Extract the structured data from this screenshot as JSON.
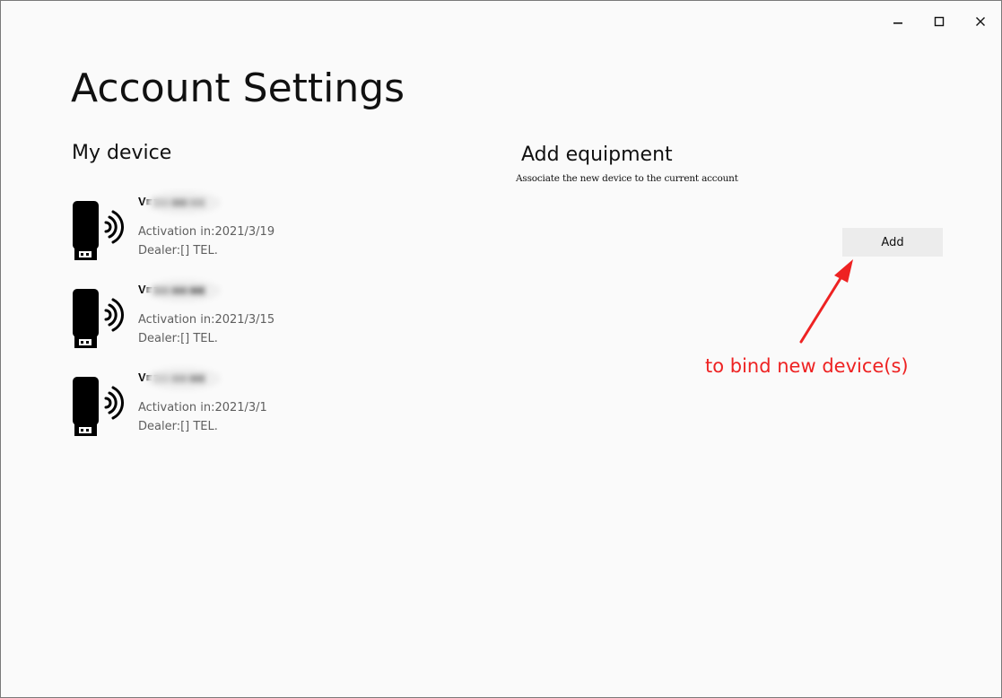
{
  "window": {
    "controls": [
      {
        "name": "minimize",
        "glyph": "–"
      },
      {
        "name": "maximize",
        "glyph": "☐"
      },
      {
        "name": "close",
        "glyph": "✕"
      }
    ]
  },
  "page": {
    "title": "Account Settings"
  },
  "my_device": {
    "heading": "My device",
    "devices": [
      {
        "name": "V■■■■■■00",
        "activation": "Activation in:2021/3/19",
        "dealer": "Dealer:[] TEL.",
        "icon": "usb-wireless-dongle-icon"
      },
      {
        "name": "V■■■■■■01",
        "activation": "Activation in:2021/3/15",
        "dealer": "Dealer:[] TEL.",
        "icon": "usb-wireless-dongle-icon"
      },
      {
        "name": "V■■■■■■00",
        "activation": "Activation in:2021/3/1",
        "dealer": "Dealer:[] TEL.",
        "icon": "usb-wireless-dongle-icon"
      }
    ]
  },
  "add_equipment": {
    "heading": "Add equipment",
    "description": "Associate the new device to the current account",
    "button_label": "Add"
  },
  "annotation": {
    "text": "to bind new device(s)",
    "color": "#ee2222"
  },
  "colors": {
    "window_bg": "#fafafa",
    "button_bg": "#ececec",
    "secondary_text": "#5f5f5f"
  }
}
